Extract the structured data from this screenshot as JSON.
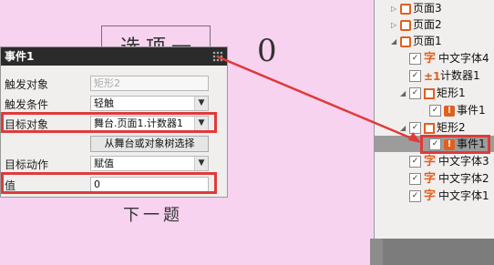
{
  "canvas": {
    "option_text": "选项一",
    "zero": "0",
    "next_question": "下一题"
  },
  "panel": {
    "title": "事件1",
    "rows": [
      {
        "label": "触发对象",
        "value": "矩形2"
      },
      {
        "label": "触发条件",
        "value": "轻触"
      },
      {
        "label": "目标对象",
        "value": "舞台.页面1.计数器1"
      },
      {
        "button": "从舞台或对象树选择"
      },
      {
        "label": "目标动作",
        "value": "赋值"
      },
      {
        "label": "值",
        "value": "0"
      }
    ]
  },
  "tree": {
    "items": [
      {
        "label": "页面3"
      },
      {
        "label": "页面2"
      },
      {
        "label": "页面1"
      },
      {
        "label": "中文字体4"
      },
      {
        "label": "计数器1"
      },
      {
        "label": "矩形1"
      },
      {
        "label": "事件1"
      },
      {
        "label": "矩形2"
      },
      {
        "label": "事件1"
      },
      {
        "label": "中文字体3"
      },
      {
        "label": "中文字体2"
      },
      {
        "label": "中文字体1"
      }
    ]
  },
  "colors": {
    "accent": "#e03a3a",
    "icon": "#e06020",
    "canvas_bg": "#f7d3f0"
  }
}
